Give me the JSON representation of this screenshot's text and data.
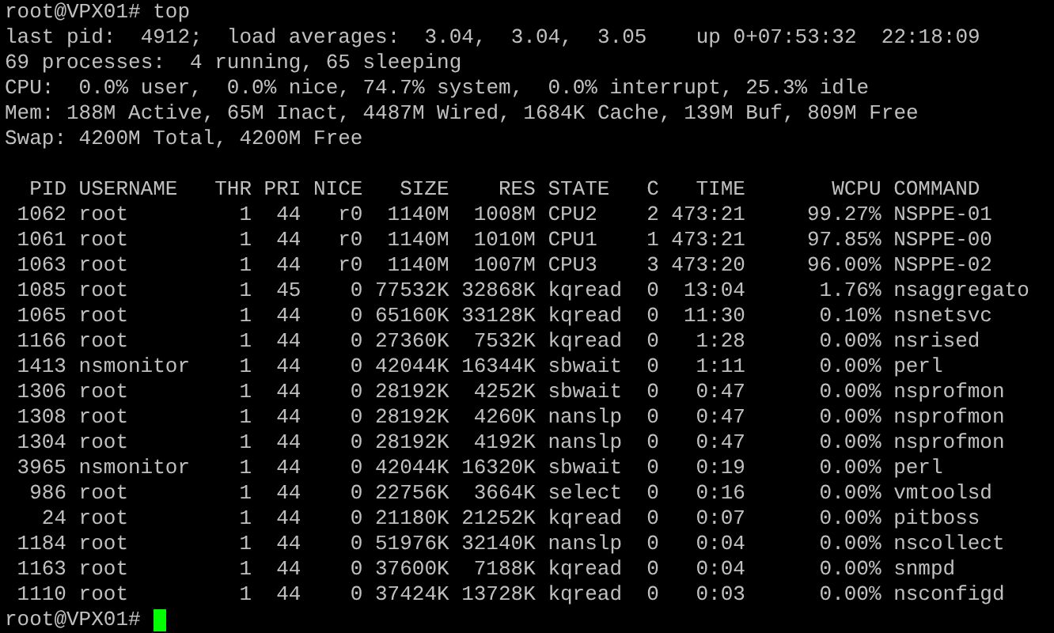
{
  "command_line": "root@VPX01# top",
  "summary_lines": [
    "last pid:  4912;  load averages:  3.04,  3.04,  3.05    up 0+07:53:32  22:18:09",
    "69 processes:  4 running, 65 sleeping",
    "CPU:  0.0% user,  0.0% nice, 74.7% system,  0.0% interrupt, 25.3% idle",
    "Mem: 188M Active, 65M Inact, 4487M Wired, 1684K Cache, 139M Buf, 809M Free",
    "Swap: 4200M Total, 4200M Free"
  ],
  "table": {
    "columns": [
      "PID",
      "USERNAME",
      "THR",
      "PRI",
      "NICE",
      "SIZE",
      "RES",
      "STATE",
      "C",
      "TIME",
      "WCPU",
      "COMMAND"
    ],
    "rows": [
      [
        "1062",
        "root",
        "1",
        "44",
        "r0",
        "1140M",
        "1008M",
        "CPU2",
        "2",
        "473:21",
        "99.27%",
        "NSPPE-01"
      ],
      [
        "1061",
        "root",
        "1",
        "44",
        "r0",
        "1140M",
        "1010M",
        "CPU1",
        "1",
        "473:21",
        "97.85%",
        "NSPPE-00"
      ],
      [
        "1063",
        "root",
        "1",
        "44",
        "r0",
        "1140M",
        "1007M",
        "CPU3",
        "3",
        "473:20",
        "96.00%",
        "NSPPE-02"
      ],
      [
        "1085",
        "root",
        "1",
        "45",
        "0",
        "77532K",
        "32868K",
        "kqread",
        "0",
        "13:04",
        "1.76%",
        "nsaggregato"
      ],
      [
        "1065",
        "root",
        "1",
        "44",
        "0",
        "65160K",
        "33128K",
        "kqread",
        "0",
        "11:30",
        "0.10%",
        "nsnetsvc"
      ],
      [
        "1166",
        "root",
        "1",
        "44",
        "0",
        "27360K",
        "7532K",
        "kqread",
        "0",
        "1:28",
        "0.00%",
        "nsrised"
      ],
      [
        "1413",
        "nsmonitor",
        "1",
        "44",
        "0",
        "42044K",
        "16344K",
        "sbwait",
        "0",
        "1:11",
        "0.00%",
        "perl"
      ],
      [
        "1306",
        "root",
        "1",
        "44",
        "0",
        "28192K",
        "4252K",
        "sbwait",
        "0",
        "0:47",
        "0.00%",
        "nsprofmon"
      ],
      [
        "1308",
        "root",
        "1",
        "44",
        "0",
        "28192K",
        "4260K",
        "nanslp",
        "0",
        "0:47",
        "0.00%",
        "nsprofmon"
      ],
      [
        "1304",
        "root",
        "1",
        "44",
        "0",
        "28192K",
        "4192K",
        "nanslp",
        "0",
        "0:47",
        "0.00%",
        "nsprofmon"
      ],
      [
        "3965",
        "nsmonitor",
        "1",
        "44",
        "0",
        "42044K",
        "16320K",
        "sbwait",
        "0",
        "0:19",
        "0.00%",
        "perl"
      ],
      [
        "986",
        "root",
        "1",
        "44",
        "0",
        "22756K",
        "3664K",
        "select",
        "0",
        "0:16",
        "0.00%",
        "vmtoolsd"
      ],
      [
        "24",
        "root",
        "1",
        "44",
        "0",
        "21180K",
        "21252K",
        "kqread",
        "0",
        "0:07",
        "0.00%",
        "pitboss"
      ],
      [
        "1184",
        "root",
        "1",
        "44",
        "0",
        "51976K",
        "32140K",
        "nanslp",
        "0",
        "0:04",
        "0.00%",
        "nscollect"
      ],
      [
        "1163",
        "root",
        "1",
        "44",
        "0",
        "37600K",
        "7188K",
        "kqread",
        "0",
        "0:04",
        "0.00%",
        "snmpd"
      ],
      [
        "1110",
        "root",
        "1",
        "44",
        "0",
        "37424K",
        "13728K",
        "kqread",
        "0",
        "0:03",
        "0.00%",
        "nsconfigd"
      ]
    ]
  },
  "prompt": "root@VPX01#"
}
